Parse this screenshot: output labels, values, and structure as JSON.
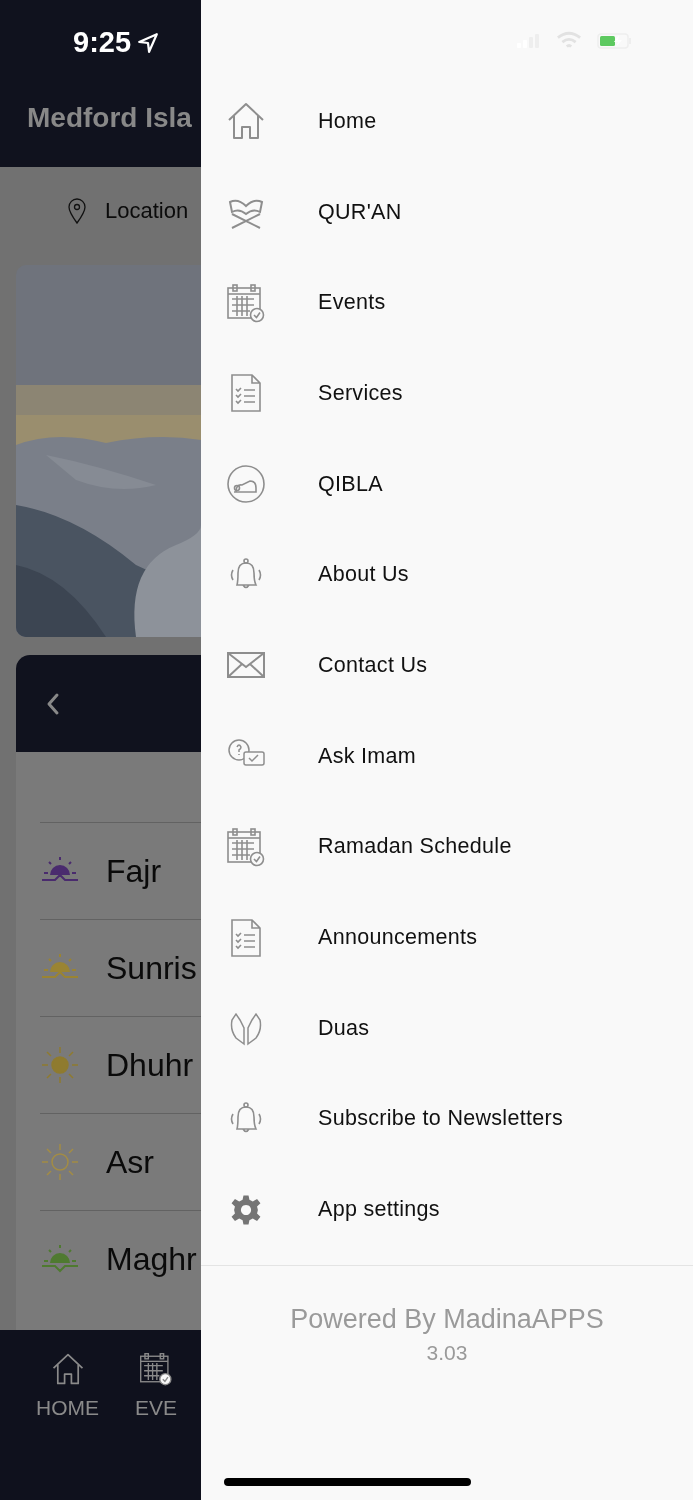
{
  "status_bar": {
    "time": "9:25"
  },
  "background_app": {
    "title": "Medford Isla",
    "location": "Location",
    "prayers": [
      {
        "name": "Fajr",
        "kind": "rise",
        "color": "#4a2b6e"
      },
      {
        "name": "Sunris",
        "kind": "rise",
        "color": "#9a8432"
      },
      {
        "name": "Dhuhr",
        "kind": "sun",
        "color": "#8f7b2f"
      },
      {
        "name": "Asr",
        "kind": "outline",
        "color": "#a38c44"
      },
      {
        "name": "Maghr",
        "kind": "set",
        "color": "#4f7a30"
      }
    ],
    "tabs": [
      {
        "label": "HOME",
        "kind": "home"
      },
      {
        "label": "EVE",
        "kind": "calendar"
      }
    ]
  },
  "drawer": {
    "items": [
      {
        "label": "Home",
        "kind": "home"
      },
      {
        "label": "QUR'AN",
        "kind": "book"
      },
      {
        "label": "Events",
        "kind": "calendar"
      },
      {
        "label": "Services",
        "kind": "document"
      },
      {
        "label": "QIBLA",
        "kind": "prayer"
      },
      {
        "label": "About Us",
        "kind": "bell"
      },
      {
        "label": "Contact Us",
        "kind": "mail"
      },
      {
        "label": "Ask Imam",
        "kind": "chat"
      },
      {
        "label": "Ramadan Schedule",
        "kind": "calendar"
      },
      {
        "label": "Announcements",
        "kind": "document"
      },
      {
        "label": "Duas",
        "kind": "hands"
      },
      {
        "label": "Subscribe to Newsletters",
        "kind": "bell"
      },
      {
        "label": "App settings",
        "kind": "gear"
      }
    ],
    "footer": {
      "powered_by": "Powered By MadinaAPPS",
      "version": "3.03"
    }
  }
}
